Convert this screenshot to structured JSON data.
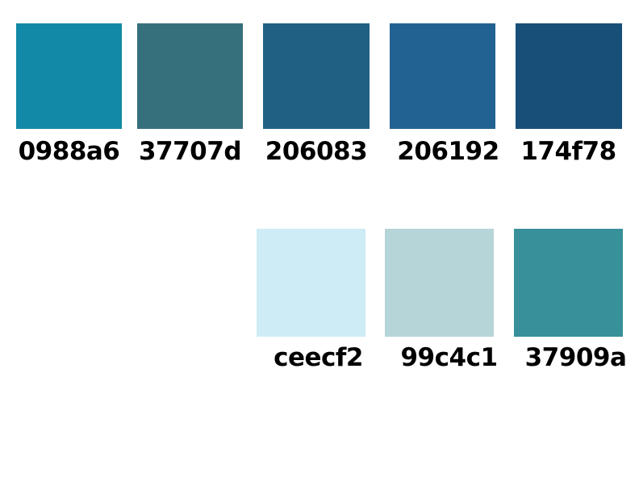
{
  "palette": {
    "row1": [
      {
        "label": "0988a6",
        "color": "#1289a6"
      },
      {
        "label": "37707d",
        "color": "#37707d"
      },
      {
        "label": "206083",
        "color": "#206083"
      },
      {
        "label": "206192",
        "color": "#226292"
      },
      {
        "label": "174f78",
        "color": "#184f78"
      }
    ],
    "row2": [
      {
        "label": "ceecf2",
        "color": "#ceecf5"
      },
      {
        "label": "99c4c1",
        "color": "#b6d5d8"
      },
      {
        "label": "37909a",
        "color": "#37909a"
      }
    ]
  }
}
